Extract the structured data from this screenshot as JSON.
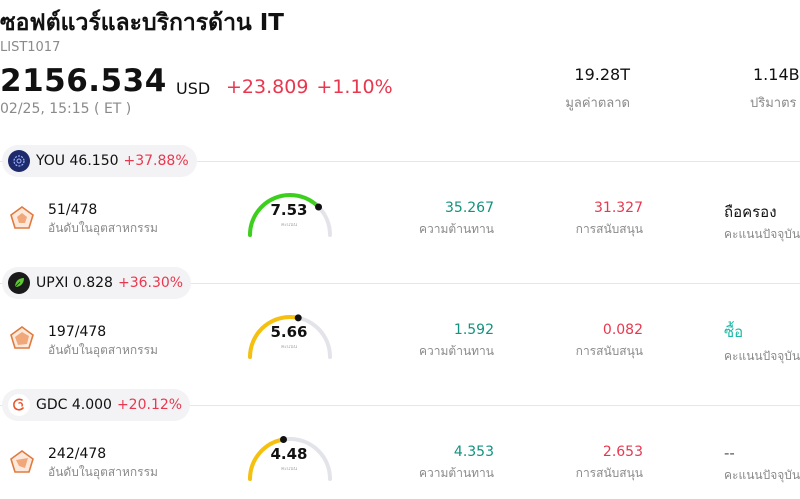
{
  "header": {
    "title": "ซอฟต์แวร์และบริการด้าน IT",
    "code": "LIST1017",
    "price": "2156.534",
    "currency": "USD",
    "change": "+23.809",
    "change_pct": "+1.10%",
    "time": "02/25, 15:15  ( ET )",
    "market_cap_value": "19.28T",
    "market_cap_label": "มูลค่าตลาด",
    "volume_value": "1.14B",
    "volume_label": "ปริมาตร"
  },
  "stocks": [
    {
      "ticker": "YOU",
      "price": "46.150",
      "pct": "+37.88%",
      "logo_icon": "clear-secure-logo-icon",
      "logo_color": "#1e2a6b",
      "rank": "51/478",
      "rank_label": "อันดับในอุตสาหกรรม",
      "score": "7.53",
      "score_fraction": 0.753,
      "score_color": "#3ccf1d",
      "score_sub": "คะแนน",
      "resistance": "35.267",
      "resistance_label": "ความต้านทาน",
      "support": "31.327",
      "support_label": "การสนับสนุน",
      "rating": "ถือครอง",
      "rating_color": "#111111",
      "rating_label": "คะแนนปัจจุบัน"
    },
    {
      "ticker": "UPXI",
      "price": "0.828",
      "pct": "+36.30%",
      "logo_icon": "upexi-leaf-logo-icon",
      "logo_color": "#1a1a1a",
      "rank": "197/478",
      "rank_label": "อันดับในอุตสาหกรรม",
      "score": "5.66",
      "score_fraction": 0.566,
      "score_color": "#f5c10e",
      "score_sub": "คะแนน",
      "resistance": "1.592",
      "resistance_label": "ความต้านทาน",
      "support": "0.082",
      "support_label": "การสนับสนุน",
      "rating": "ซื้อ",
      "rating_color": "#1fb8a8",
      "rating_label": "คะแนนปัจจุบัน"
    },
    {
      "ticker": "GDC",
      "price": "4.000",
      "pct": "+20.12%",
      "logo_icon": "gd-culture-logo-icon",
      "logo_color": "#ffffff",
      "rank": "242/478",
      "rank_label": "อันดับในอุตสาหกรรม",
      "score": "4.48",
      "score_fraction": 0.448,
      "score_color": "#f5c10e",
      "score_sub": "คะแนน",
      "resistance": "4.353",
      "resistance_label": "ความต้านทาน",
      "support": "2.653",
      "support_label": "การสนับสนุน",
      "rating": "--",
      "rating_color": "#555555",
      "rating_label": "คะแนนปัจจุบัน"
    }
  ]
}
